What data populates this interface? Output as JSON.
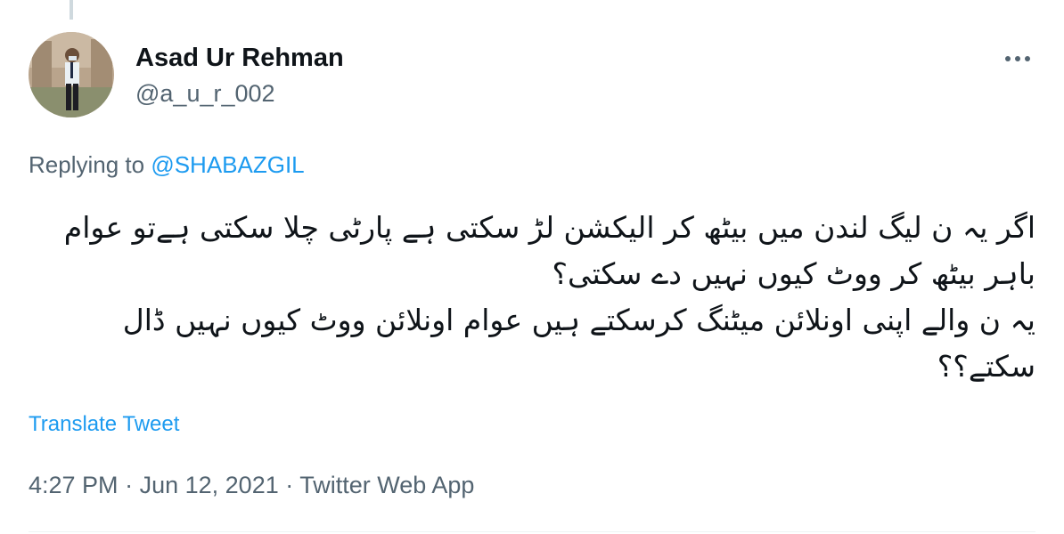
{
  "tweet": {
    "author": {
      "display_name": "Asad Ur Rehman",
      "handle": "@a_u_r_002"
    },
    "replying_prefix": "Replying to",
    "replying_to": "@SHABAZGIL",
    "text_paragraphs": [
      "اگر یہ ن لیگ لندن میں بیٹھ کر الیکشن لڑ سکتی ہے پارٹی چلا سکتی ہےتو عوام  باہر بیٹھ کر ووٹ کیوں نہیں دے سکتی؟",
      "یہ ن والے اپنی اونلائن میٹنگ کرسکتے ہیں عوام اونلائن ووٹ کیوں نہیں ڈال سکتے؟؟"
    ],
    "translate_label": "Translate Tweet",
    "time": "4:27 PM",
    "date": "Jun 12, 2021",
    "source": "Twitter Web App",
    "separator": "·"
  },
  "icons": {
    "more": "more-horizontal-icon"
  },
  "colors": {
    "link": "#1d9bf0",
    "secondary_text": "#536471",
    "primary_text": "#0f1419",
    "divider": "#eff3f4"
  }
}
